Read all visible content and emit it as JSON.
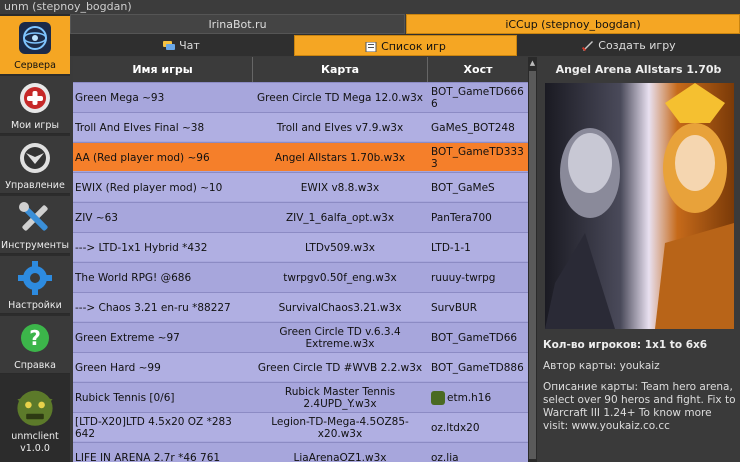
{
  "window": {
    "title": "unm (stepnoy_bogdan)"
  },
  "sidebar": {
    "items": [
      {
        "label": "Сервера",
        "icon": "servers-icon",
        "active": true
      },
      {
        "label": "Мои игры",
        "icon": "gamepad-icon",
        "active": false
      },
      {
        "label": "Управление",
        "icon": "control-icon",
        "active": false
      },
      {
        "label": "Инструменты",
        "icon": "tools-icon",
        "active": false
      },
      {
        "label": "Настройки",
        "icon": "settings-icon",
        "active": false
      },
      {
        "label": "Справка",
        "icon": "help-icon",
        "active": false
      }
    ],
    "client_name": "unmclient",
    "client_version": "v1.0.0"
  },
  "server_tabs": [
    {
      "label": "IrinaBot.ru",
      "active": false
    },
    {
      "label": "iCCup (stepnoy_bogdan)",
      "active": true
    }
  ],
  "sub_tabs": [
    {
      "label": "Чат",
      "icon": "chat-icon",
      "active": false
    },
    {
      "label": "Список игр",
      "icon": "list-icon",
      "active": true
    },
    {
      "label": "Создать игру",
      "icon": "sword-icon",
      "active": false
    }
  ],
  "games_table": {
    "columns": [
      "Имя игры",
      "Карта",
      "Хост"
    ],
    "rows": [
      {
        "name": "Green Mega ~93",
        "map": "Green Circle TD Mega 12.0.w3x",
        "host": "BOT_GameTD6666"
      },
      {
        "name": "Troll And Elves Final ~38",
        "map": "Troll and Elves v7.9.w3x",
        "host": "GaMeS_BOT248"
      },
      {
        "name": "AA (Red player mod) ~96",
        "map": "Angel Allstars 1.70b.w3x",
        "host": "BOT_GameTD3333"
      },
      {
        "name": "EWIX (Red player mod) ~10",
        "map": "EWIX v8.8.w3x",
        "host": "BOT_GaMeS"
      },
      {
        "name": "ZIV ~63",
        "map": "ZIV_1_6alfa_opt.w3x",
        "host": "PanTera700"
      },
      {
        "name": "---> LTD-1x1 Hybrid *432",
        "map": "LTDv509.w3x",
        "host": "LTD-1-1"
      },
      {
        "name": "The World RPG! @686",
        "map": "twrpgv0.50f_eng.w3x",
        "host": "ruuuy-twrpg"
      },
      {
        "name": "---> Chaos 3.21 en-ru *88227",
        "map": "SurvivalChaos3.21.w3x",
        "host": "SurvBUR"
      },
      {
        "name": "Green Extreme ~97",
        "map": "Green Circle TD v.6.3.4 Extreme.w3x",
        "host": "BOT_GameTD66"
      },
      {
        "name": "Green Hard ~99",
        "map": "Green Circle TD #WVB 2.2.w3x",
        "host": "BOT_GameTD886"
      },
      {
        "name": "Rubick Tennis [0/6]",
        "map": "Rubick Master Tennis 2.4UPD_Y.w3x",
        "host": "etm.h16"
      },
      {
        "name": "[LTD-X20]LTD 4.5x20 OZ *283 642",
        "map": "Legion-TD-Mega-4.5OZ85-x20.w3x",
        "host": "oz.ltdx20"
      },
      {
        "name": "LIFE IN ARENA 2.7r *46 761",
        "map": "LiaArenaOZ1.w3x",
        "host": "oz.lia"
      }
    ]
  },
  "details": {
    "title": "Angel Arena Allstars 1.70b",
    "players": "Кол-во игроков: 1x1 to 6x6",
    "author": "Автор карты: youkaiz",
    "description": "Описание карты: Team hero arena, select over 90 heros and fight. Fix to Warcraft III 1.24+ To know more visit: www.youkaiz.co.cc"
  },
  "colors": {
    "accent": "#f5a623",
    "selected_row": "#f57f2a",
    "row_bg": "#a7a6dc"
  }
}
